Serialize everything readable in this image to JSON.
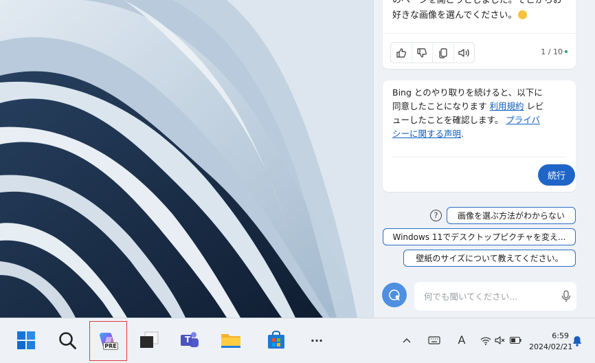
{
  "copilot": {
    "message_lines": [
      "のページを開こうとしました。そこからお",
      "好きな画像を選んでください。"
    ],
    "counter": "1 / 10",
    "terms": {
      "line1": "Bing とのやり取りを続けると、以下に",
      "line2_prefix": "同意したことになります ",
      "link_terms": "利用規約",
      "line2_suffix": " レビ",
      "line3_prefix": "ューしたことを確認します。 ",
      "link_privacy_a": "プライバ",
      "link_privacy_b": "シーに関する声明",
      "line4_suffix": "."
    },
    "continue_label": "続行",
    "suggestions": [
      "画像を選ぶ方法がわからない",
      "Windows 11でデスクトップピクチャを変え...",
      "壁紙のサイズについて教えてください。"
    ],
    "input_placeholder": "何でも聞いてください..."
  },
  "taskbar": {
    "time": "6:59",
    "date": "2024/02/21",
    "copilot_badge": "PRE",
    "teams_letter": "T",
    "ime_letter": "A",
    "more": "···"
  }
}
